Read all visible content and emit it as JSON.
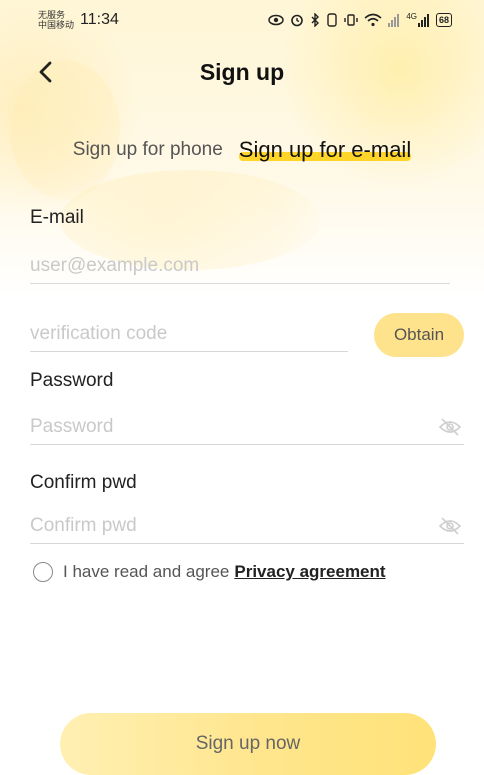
{
  "status_bar": {
    "carrier_line1": "无服务",
    "carrier_line2": "中国移动",
    "time": "11:34",
    "network_label": "4G",
    "battery": "68"
  },
  "header": {
    "title": "Sign up"
  },
  "tabs": [
    {
      "label": "Sign up for phone",
      "active": false
    },
    {
      "label": "Sign up for e-mail",
      "active": true
    }
  ],
  "form": {
    "email_label": "E-mail",
    "email_placeholder": "user@example.com",
    "code_placeholder": "verification code",
    "obtain_label": "Obtain",
    "password_label": "Password",
    "password_placeholder": "Password",
    "confirm_label": "Confirm pwd",
    "confirm_placeholder": "Confirm pwd"
  },
  "agreement": {
    "text": "I have read and agree",
    "link": "Privacy agreement"
  },
  "submit_label": "Sign up now",
  "colors": {
    "accent": "#ffd52a",
    "button": "#ffe38c"
  }
}
